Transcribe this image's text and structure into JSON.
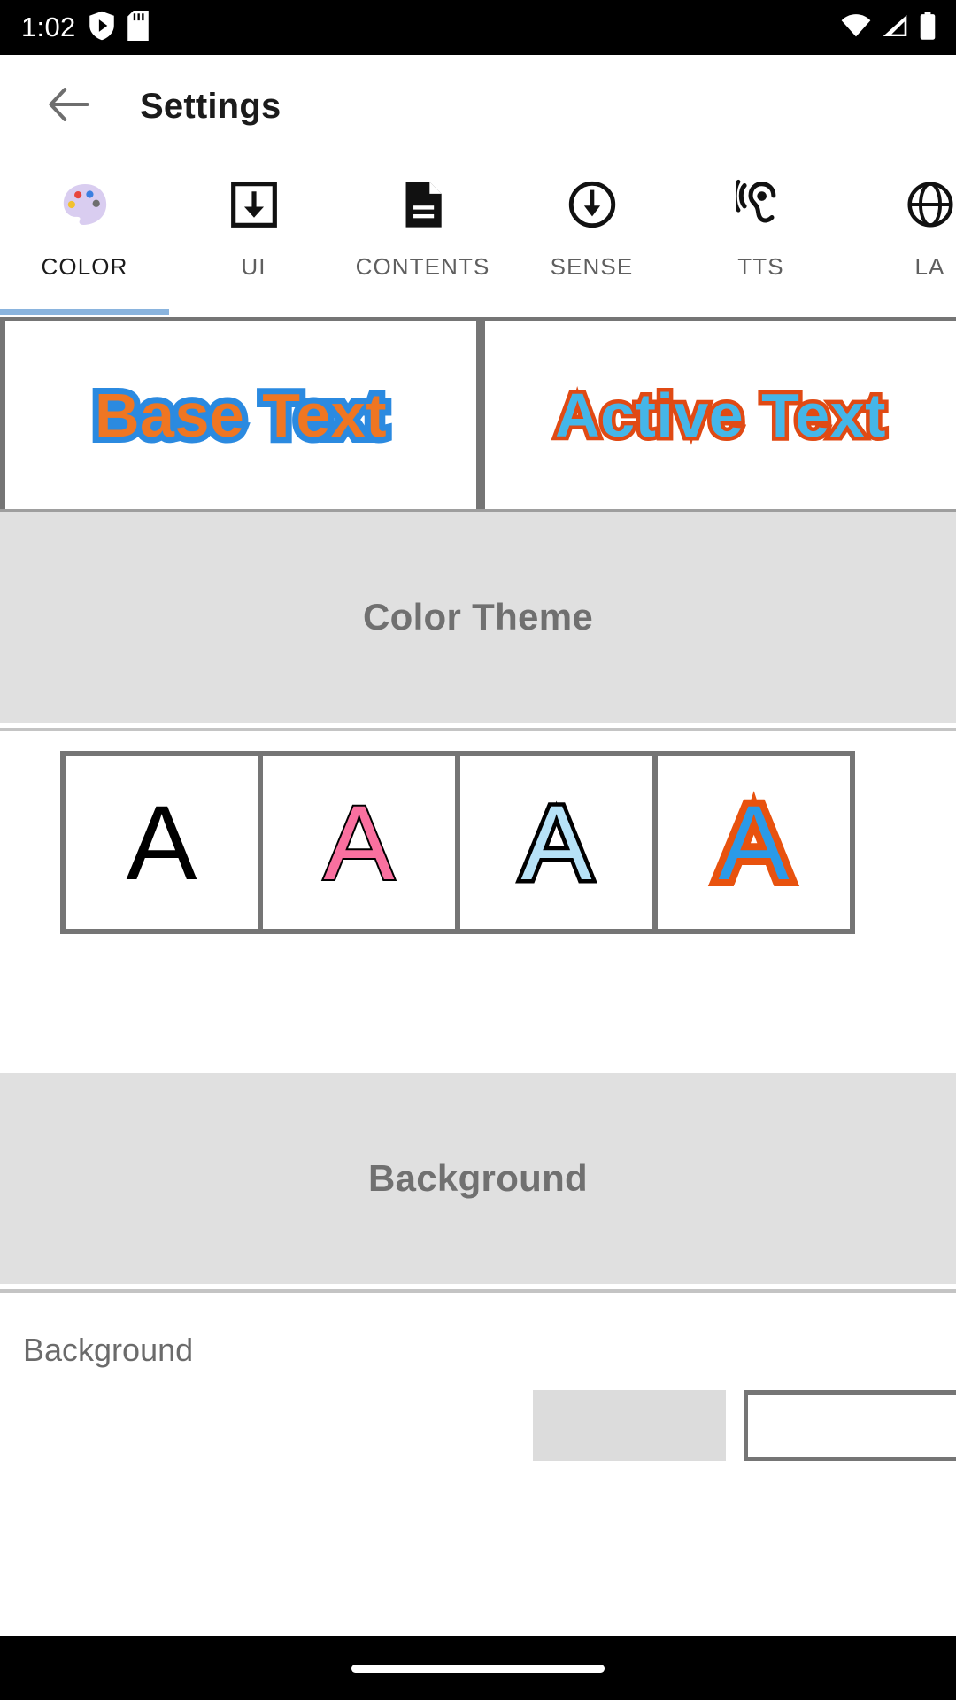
{
  "status_bar": {
    "time": "1:02",
    "left_icons": [
      "shield-play-icon",
      "sd-card-icon"
    ],
    "right_icons": [
      "wifi-icon",
      "cellular-signal-icon",
      "battery-icon"
    ]
  },
  "app_bar": {
    "back_icon": "back-arrow-icon",
    "title": "Settings"
  },
  "tabs": {
    "active_index": 0,
    "indicator_color": "#8ab4de",
    "items": [
      {
        "label": "COLOR",
        "icon": "palette-icon"
      },
      {
        "label": "UI",
        "icon": "boxed-download-arrow-icon"
      },
      {
        "label": "CONTENTS",
        "icon": "document-icon"
      },
      {
        "label": "SENSE",
        "icon": "circled-down-arrow-icon"
      },
      {
        "label": "TTS",
        "icon": "hearing-ear-icon"
      },
      {
        "label": "LA",
        "icon": "language-icon"
      }
    ]
  },
  "preview": {
    "base": {
      "text": "Base Text",
      "fill_color": "#ef7622",
      "outline_color": "#2b8ae0"
    },
    "active": {
      "text": "Active Text",
      "fill_color": "#45b6e8",
      "outline_color": "#e04a14"
    }
  },
  "color_theme_section": {
    "title": "Color Theme",
    "swatches": [
      {
        "letter": "A",
        "fill_color": "#000000",
        "outline_color": "#000000"
      },
      {
        "letter": "A",
        "fill_color": "#f9709f",
        "outline_color": "#000000"
      },
      {
        "letter": "A",
        "fill_color": "#b6e2f7",
        "outline_color": "#000000"
      },
      {
        "letter": "A",
        "fill_color": "#2b9ae8",
        "outline_color": "#e8520e"
      }
    ]
  },
  "background_section": {
    "title": "Background",
    "row_label": "Background",
    "swatches": [
      {
        "name": "gray-swatch",
        "color": "#dcdcdc"
      },
      {
        "name": "white-swatch",
        "color": "#ffffff"
      }
    ]
  },
  "nav_bar": {
    "handle": "gesture-pill"
  }
}
